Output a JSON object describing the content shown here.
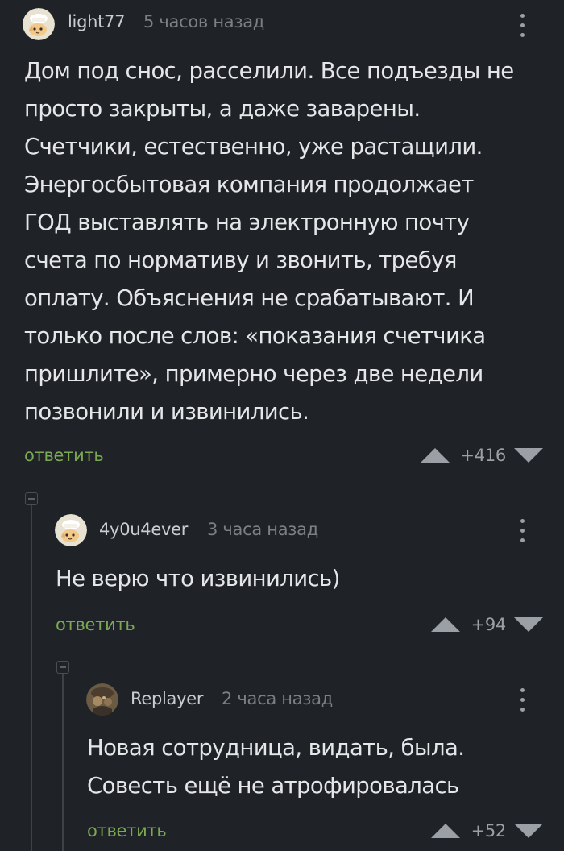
{
  "comments": [
    {
      "username": "light77",
      "time": "5 часов назад",
      "avatar_icon": "cat-chef-avatar-icon",
      "lines": [
        "Дом под снос, расселили. Все подъезды не",
        "просто закрыты, а даже заварены.",
        "Счетчики, естественно, уже растащили.",
        "Энергосбытовая компания продолжает",
        "ГОД выставлять на электронную почту",
        "счета по нормативу и звонить, требуя",
        "оплату. Объяснения не срабатывают. И",
        "только после слов: «показания счетчика",
        "пришлите», примерно через две недели",
        "позвонили и извинились."
      ],
      "reply_label": "ответить",
      "rating": "+416"
    },
    {
      "username": "4y0u4ever",
      "time": "3 часа назад",
      "avatar_icon": "cat-chef-avatar-icon",
      "lines": [
        "Не верю что извинились)"
      ],
      "reply_label": "ответить",
      "rating": "+94"
    },
    {
      "username": "Replayer",
      "time": "2 часа назад",
      "avatar_icon": "photo-avatar-icon",
      "lines": [
        "Новая сотрудница, видать, была.",
        "Совесть ещё не атрофировалась"
      ],
      "reply_label": "ответить",
      "rating": "+52"
    }
  ],
  "colors": {
    "background": "#1f2226",
    "text": "#e4e6e8",
    "username": "#c9cdd1",
    "muted": "#7b8086",
    "reply": "#79a953",
    "icon": "#9aa0a6"
  }
}
